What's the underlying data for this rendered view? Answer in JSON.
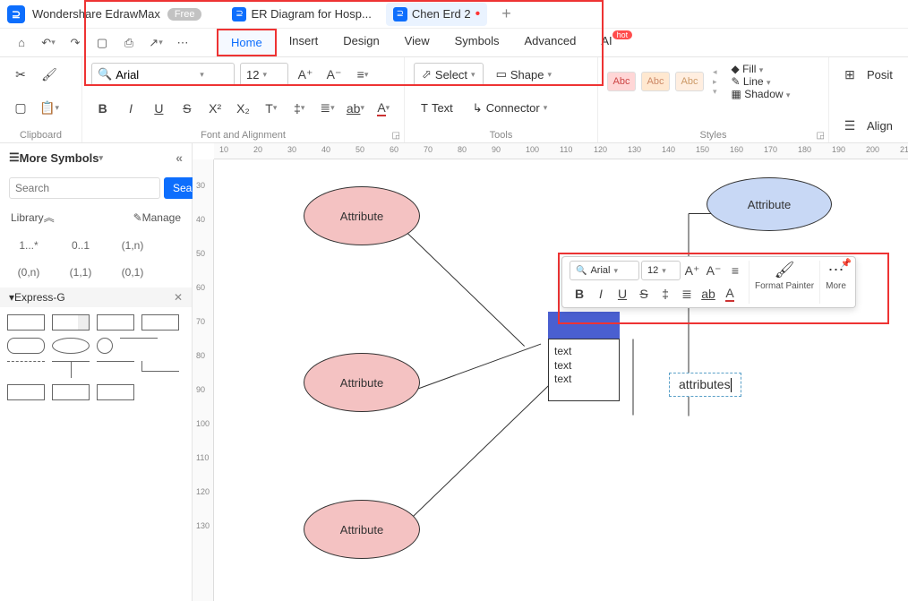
{
  "titlebar": {
    "app_name": "Wondershare EdrawMax",
    "free_badge": "Free",
    "tabs": [
      {
        "label": "ER Diagram for Hosp...",
        "active": false,
        "dirty": false
      },
      {
        "label": "Chen Erd 2",
        "active": true,
        "dirty": true
      }
    ]
  },
  "menu": {
    "items": [
      "Home",
      "Insert",
      "Design",
      "View",
      "Symbols",
      "Advanced",
      "AI"
    ],
    "active": "Home",
    "hot_badge": "hot"
  },
  "ribbon": {
    "clipboard_label": "Clipboard",
    "font_family": "Arial",
    "font_size": "12",
    "font_group_label": "Font and Alignment",
    "tools": {
      "select_label": "Select",
      "shape_label": "Shape",
      "text_label": "Text",
      "connector_label": "Connector",
      "group_label": "Tools"
    },
    "styles": {
      "swatches": [
        "Abc",
        "Abc",
        "Abc"
      ],
      "fill": "Fill",
      "line": "Line",
      "shadow": "Shadow",
      "group_label": "Styles"
    },
    "right": {
      "posit": "Posit",
      "align": "Align"
    }
  },
  "sidebar": {
    "title": "More Symbols",
    "search_placeholder": "Search",
    "search_btn": "Search",
    "library_label": "Library",
    "manage_label": "Manage",
    "cardinality": [
      "1...*",
      "0..1",
      "(1,n)",
      "(0,n)",
      "(1,1)",
      "(0,1)"
    ],
    "expressg": "Express-G"
  },
  "ruler_h": [
    "10",
    "20",
    "30",
    "40",
    "50",
    "60",
    "70",
    "80",
    "90",
    "100",
    "110",
    "120",
    "130",
    "140",
    "150",
    "160",
    "170",
    "180",
    "190",
    "200",
    "21"
  ],
  "ruler_v": [
    "30",
    "40",
    "50",
    "60",
    "70",
    "80",
    "90",
    "100",
    "110",
    "120",
    "130"
  ],
  "canvas": {
    "attr1": "Attribute",
    "attr2": "Attribute",
    "attr3": "Attribute",
    "attr4": "Attribute",
    "entity_text": "text\ntext\ntext",
    "editing_text": "attributes"
  },
  "float": {
    "font": "Arial",
    "size": "12",
    "format_painter": "Format Painter",
    "more": "More"
  }
}
